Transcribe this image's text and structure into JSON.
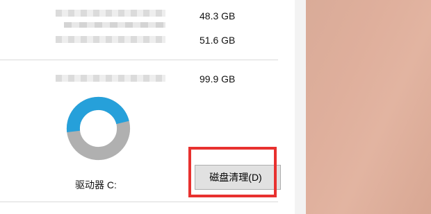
{
  "items": [
    {
      "size": "48.3 GB"
    },
    {
      "size": "51.6 GB"
    },
    {
      "size": "99.9 GB"
    }
  ],
  "drive": {
    "label": "驱动器 C:",
    "used_fraction": 0.48,
    "used_color": "#26a0da",
    "free_color": "#b0b0b0"
  },
  "buttons": {
    "disk_cleanup": "磁盘清理(D)"
  },
  "highlight_color": "#e8312f",
  "icons": [
    "drive-usage-donut-icon"
  ]
}
